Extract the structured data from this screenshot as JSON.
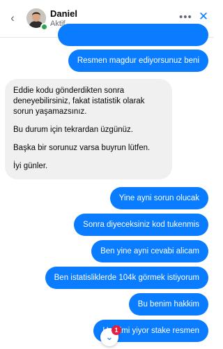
{
  "header": {
    "back_icon": "chevron-left-icon",
    "contact_name": "Daniel",
    "status": "Aktif",
    "more_icon": "more-horizontal-icon",
    "close_icon": "close-icon",
    "online_color": "#31a24c"
  },
  "colors": {
    "outgoing_bubble": "#0a7cff",
    "incoming_bubble": "#f0f0f0",
    "badge": "#e41e3f"
  },
  "messages": {
    "outgoing_1": "Resmen magdur ediyorsunuz beni",
    "incoming_1": {
      "p1": "Eddie kodu gönderdikten sonra deneyebilirsiniz, fakat istatistik olarak sorun yaşamazsınız.",
      "p2": "Bu durum için tekrardan üzgünüz.",
      "p3": "Başka bir sorunuz varsa buyrun lütfen.",
      "p4": "İyi günler."
    },
    "outgoing_2": "Yine ayni sorun olucak",
    "outgoing_3": "Sonra diyeceksiniz kod tukenmis",
    "outgoing_4": "Ben yine ayni cevabi alicam",
    "outgoing_5": "Ben istatisliklerde 104k görmek istiyorum",
    "outgoing_6": "Bu benim hakkim",
    "outgoing_7": "Herkimi yiyor stake resmen"
  },
  "scroll": {
    "icon": "chevron-down-icon",
    "unread_count": "1"
  }
}
